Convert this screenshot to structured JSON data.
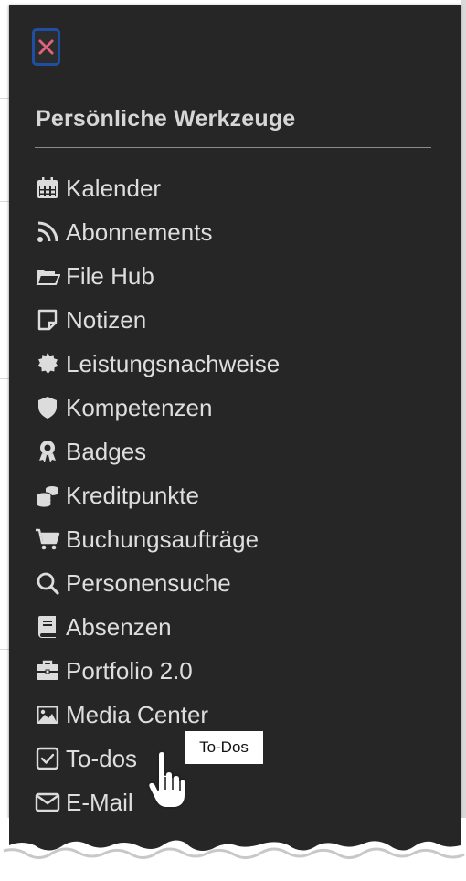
{
  "panel": {
    "close_label": "Close",
    "section_title": "Persönliche Werkzeuge"
  },
  "menu_items": [
    {
      "label": "Kalender",
      "icon": "calendar-icon"
    },
    {
      "label": "Abonnements",
      "icon": "rss-icon"
    },
    {
      "label": "File Hub",
      "icon": "folder-open-icon"
    },
    {
      "label": "Notizen",
      "icon": "sticky-note-icon"
    },
    {
      "label": "Leistungsnachweise",
      "icon": "certificate-icon"
    },
    {
      "label": "Kompetenzen",
      "icon": "shield-icon"
    },
    {
      "label": "Badges",
      "icon": "award-icon"
    },
    {
      "label": "Kreditpunkte",
      "icon": "coins-icon"
    },
    {
      "label": "Buchungsaufträge",
      "icon": "cart-icon"
    },
    {
      "label": "Personensuche",
      "icon": "search-icon"
    },
    {
      "label": "Absenzen",
      "icon": "book-icon"
    },
    {
      "label": "Portfolio 2.0",
      "icon": "briefcase-icon"
    },
    {
      "label": "Media Center",
      "icon": "image-icon"
    },
    {
      "label": "To-dos",
      "icon": "check-square-icon"
    },
    {
      "label": "E-Mail",
      "icon": "envelope-icon"
    }
  ],
  "tooltip": {
    "text": "To-Dos"
  },
  "colors": {
    "panel_bg": "#262626",
    "text": "#dedede",
    "close_border": "#1f4fa5",
    "close_x": "#e0627c"
  }
}
